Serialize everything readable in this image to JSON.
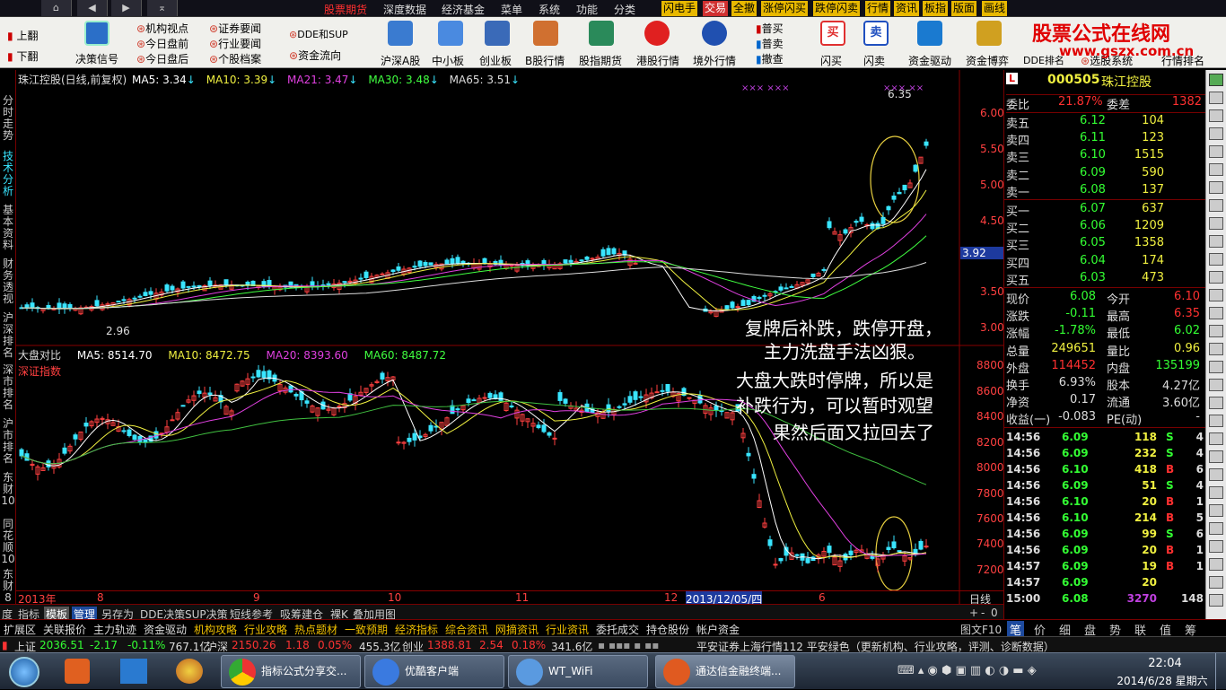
{
  "menubar": {
    "nav": [
      "⌂",
      "◀",
      "▶",
      "⌅"
    ],
    "items": [
      "股票期货",
      "深度数据",
      "经济基金",
      "菜单",
      "系统",
      "功能",
      "分类"
    ],
    "active": "股票期货",
    "red_tabs": [
      "闪电手",
      "交易",
      "全撤",
      "涨停闪买",
      "跌停闪卖",
      "行情",
      "资讯",
      "板指",
      "版面",
      "画线"
    ]
  },
  "toolbar": {
    "items": [
      "上翻",
      "下翻",
      "决策信号",
      "机构视点",
      "今日盘前",
      "今日盘后",
      "证券要闻",
      "行业要闻",
      "个股档案",
      "DDE和SUP",
      "资金流向",
      "沪深A股",
      "中小板",
      "创业板",
      "B股行情",
      "股指期货",
      "港股行情",
      "境外行情",
      "普买",
      "普卖",
      "撤查",
      "闪买",
      "闪卖",
      "资金驱动",
      "资金博弈",
      "DDE排名",
      "选股系统",
      "行情排名"
    ]
  },
  "logo": {
    "title": "股票公式在线网",
    "url": "www.gszx.com.cn"
  },
  "left_tabs": [
    "分时走势",
    "技术分析",
    "基本资料",
    "财务透视",
    "沪深排名",
    "深市排名",
    "沪市排名",
    "东财10",
    "同花顺10",
    "东财8"
  ],
  "upper_legend": {
    "name": "珠江控股(日线,前复权)",
    "ma5": "MA5: 3.34",
    "ma10": "MA10: 3.39",
    "ma21": "MA21: 3.47",
    "ma30": "MA30: 3.48",
    "ma65": "MA65: 3.51"
  },
  "upper_axis": [
    "6.00",
    "5.50",
    "5.00",
    "4.50",
    "3.92",
    "3.50",
    "3.00"
  ],
  "upper_labels": {
    "high": "6.35",
    "low": "2.96"
  },
  "lower_legend": {
    "name": "大盘对比",
    "index": "深证指数",
    "ma5": "MA5: 8514.70",
    "ma10": "MA10: 8472.75",
    "ma20": "MA20: 8393.60",
    "ma60": "MA60: 8487.72"
  },
  "lower_axis": [
    "8800",
    "8600",
    "8400",
    "8200",
    "8000",
    "7800",
    "7600",
    "7400",
    "7200"
  ],
  "x_axis": [
    "2013年",
    "8",
    "9",
    "10",
    "11",
    "12",
    "2013/12/05/四",
    "6",
    "日线"
  ],
  "annotation": [
    "复牌后补跌，跌停开盘，",
    "主力洗盘手法凶狠。",
    "大盘大跌时停牌，所以是",
    "补跌行为，可以暂时观望",
    "果然后面又拉回去了"
  ],
  "quote": {
    "code": "000505",
    "name": "珠江控股",
    "wb_label": "委比",
    "wb": "21.87%",
    "wc_label": "委差",
    "wc": "1382",
    "sells": [
      {
        "l": "卖五",
        "p": "6.12",
        "v": "104"
      },
      {
        "l": "卖四",
        "p": "6.11",
        "v": "123"
      },
      {
        "l": "卖三",
        "p": "6.10",
        "v": "1515"
      },
      {
        "l": "卖二",
        "p": "6.09",
        "v": "590"
      },
      {
        "l": "卖一",
        "p": "6.08",
        "v": "137"
      }
    ],
    "buys": [
      {
        "l": "买一",
        "p": "6.07",
        "v": "637"
      },
      {
        "l": "买二",
        "p": "6.06",
        "v": "1209"
      },
      {
        "l": "买三",
        "p": "6.05",
        "v": "1358"
      },
      {
        "l": "买四",
        "p": "6.04",
        "v": "174"
      },
      {
        "l": "买五",
        "p": "6.03",
        "v": "473"
      }
    ],
    "stats": [
      {
        "a": "现价",
        "av": "6.08",
        "b": "今开",
        "bv": "6.10"
      },
      {
        "a": "涨跌",
        "av": "-0.11",
        "b": "最高",
        "bv": "6.35"
      },
      {
        "a": "涨幅",
        "av": "-1.78%",
        "b": "最低",
        "bv": "6.02"
      },
      {
        "a": "总量",
        "av": "249651",
        "b": "量比",
        "bv": "0.96"
      },
      {
        "a": "外盘",
        "av": "114452",
        "b": "内盘",
        "bv": "135199"
      },
      {
        "a": "换手",
        "av": "6.93%",
        "b": "股本",
        "bv": "4.27亿"
      },
      {
        "a": "净资",
        "av": "0.17",
        "b": "流通",
        "bv": "3.60亿"
      },
      {
        "a": "收益(一)",
        "av": "-0.083",
        "b": "PE(动)",
        "bv": "-"
      }
    ],
    "ticks": [
      [
        "14:56",
        "6.09",
        "118",
        "S",
        "4"
      ],
      [
        "14:56",
        "6.09",
        "232",
        "S",
        "4"
      ],
      [
        "14:56",
        "6.10",
        "418",
        "B",
        "6"
      ],
      [
        "14:56",
        "6.09",
        "51",
        "S",
        "4"
      ],
      [
        "14:56",
        "6.10",
        "20",
        "B",
        "1"
      ],
      [
        "14:56",
        "6.10",
        "214",
        "B",
        "5"
      ],
      [
        "14:56",
        "6.09",
        "99",
        "S",
        "6"
      ],
      [
        "14:56",
        "6.09",
        "20",
        "B",
        "1"
      ],
      [
        "14:57",
        "6.09",
        "19",
        "B",
        "1"
      ],
      [
        "14:57",
        "6.09",
        "20",
        "",
        ""
      ],
      [
        "15:00",
        "6.08",
        "3270",
        "",
        "148"
      ]
    ]
  },
  "bottom_tabs": [
    "度",
    "指标",
    "模板",
    "管理",
    "另存为",
    "DDE决策",
    "SUP决策",
    "短线参考",
    "吸筹建仓",
    "裸K",
    "叠加用图"
  ],
  "bottom_tabs_active": "模板",
  "bottom_tabs2": [
    "扩展区",
    "关联报价",
    "主力轨迹",
    "资金驱动",
    "机构攻略",
    "行业攻略",
    "热点题材",
    "一致预期",
    "经济指标",
    "综合资讯",
    "网摘资讯",
    "行业资讯",
    "委托成交",
    "持仓股份",
    "帐户资金"
  ],
  "right_tabs": [
    "图文F10",
    "笔",
    "价",
    "细",
    "盘",
    "势",
    "联",
    "值",
    "筹"
  ],
  "status": {
    "sh": "上证",
    "sh_v": "2036.51",
    "sh_c": "-2.17",
    "sh_p": "-0.11%",
    "sh_a": "767.1亿",
    "hs": "沪深",
    "hs_v": "2150.26",
    "hs_c": "1.18",
    "hs_p": "0.05%",
    "hs_a": "455.3亿",
    "cy": "创业",
    "cy_v": "1388.81",
    "cy_c": "2.54",
    "cy_p": "0.18%",
    "cy_a": "341.6亿",
    "news": "平安证券上海行情112  平安绿色（更新机构、行业攻略，评测、诊断数据）"
  },
  "taskbar": {
    "tasks": [
      "指标公式分享交...",
      "优酷客户端",
      "WT_WiFi",
      "通达信金融终端..."
    ],
    "time": "22:04",
    "date": "2014/6/28 星期六"
  }
}
